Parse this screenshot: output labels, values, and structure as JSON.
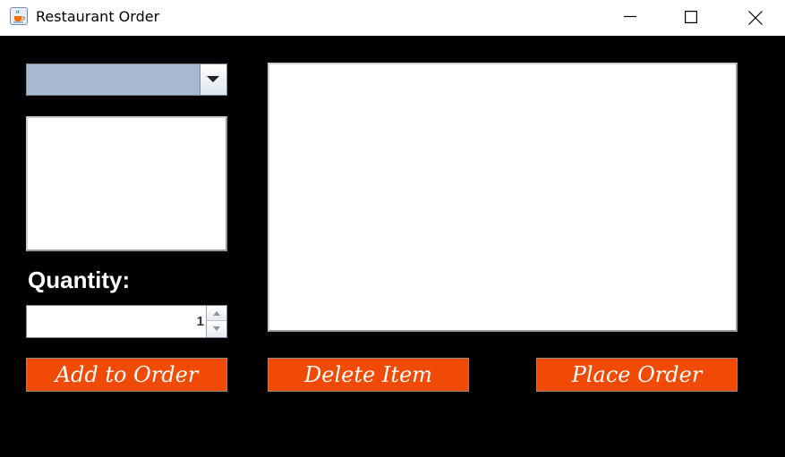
{
  "window": {
    "title": "Restaurant Order",
    "icon": "java-cup-icon",
    "controls": {
      "minimize": "minimize-icon",
      "maximize": "maximize-icon",
      "close": "close-icon"
    }
  },
  "menu_combo": {
    "selected": "",
    "arrow_icon": "chevron-down-icon"
  },
  "quantity": {
    "label": "Quantity:",
    "value": "1"
  },
  "buttons": {
    "add": "Add to Order",
    "delete": "Delete Item",
    "place": "Place Order"
  },
  "colors": {
    "background": "#000000",
    "button": "#f14a04",
    "combo": "#a6b9cf"
  }
}
